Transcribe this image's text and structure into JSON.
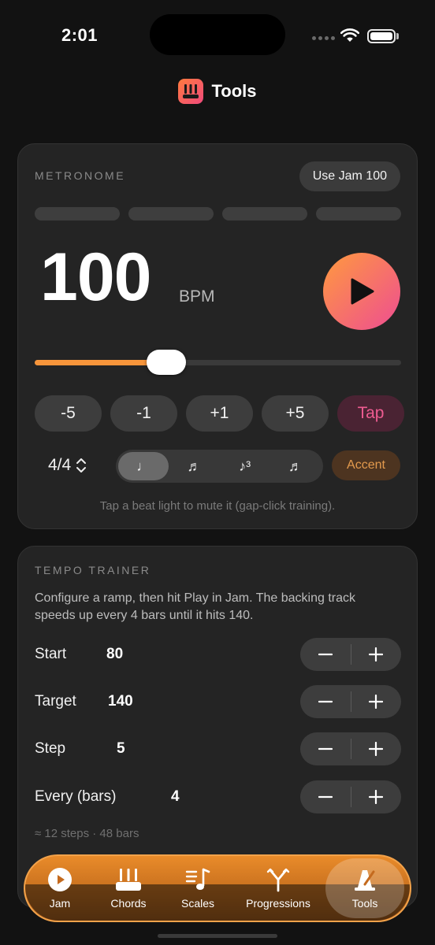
{
  "status": {
    "time": "2:01"
  },
  "header": {
    "title": "Tools"
  },
  "metronome": {
    "section_label": "METRONOME",
    "use_jam_label": "Use Jam 100",
    "beat_count": 4,
    "bpm_value": "100",
    "bpm_unit": "BPM",
    "tempo_level": 0.36,
    "steps": [
      "-5",
      "-1",
      "+1",
      "+5"
    ],
    "tap_label": "Tap",
    "meter_label": "4/4",
    "subdivisions": [
      "♩",
      "♬",
      "♪³",
      "♬"
    ],
    "active_subdivision": 0,
    "accent_label": "Accent",
    "hint": "Tap a beat light to mute it (gap-click training)."
  },
  "trainer": {
    "section_label": "TEMPO TRAINER",
    "description": "Configure a ramp, then hit Play in Jam. The backing track speeds up every 4 bars until it hits 140.",
    "params": [
      {
        "label": "Start",
        "value": "80"
      },
      {
        "label": "Target",
        "value": "140"
      },
      {
        "label": "Step",
        "value": "5"
      },
      {
        "label": "Every (bars)",
        "value": "4"
      }
    ],
    "summary": "≈ 12 steps · 48 bars"
  },
  "tabs": [
    {
      "label": "Jam",
      "icon": "play-circle-icon"
    },
    {
      "label": "Chords",
      "icon": "guitar-chords-icon"
    },
    {
      "label": "Scales",
      "icon": "music-notes-icon"
    },
    {
      "label": "Progressions",
      "icon": "branch-icon"
    },
    {
      "label": "Tools",
      "icon": "metronome-icon"
    }
  ],
  "active_tab": "Tools",
  "colors": {
    "background": "#121212",
    "card": "#242424",
    "accent_orange": "#f7953b",
    "accent_pink": "#ee4d92",
    "tap_text": "#ee5c91",
    "accent_text": "#e39a4d"
  }
}
